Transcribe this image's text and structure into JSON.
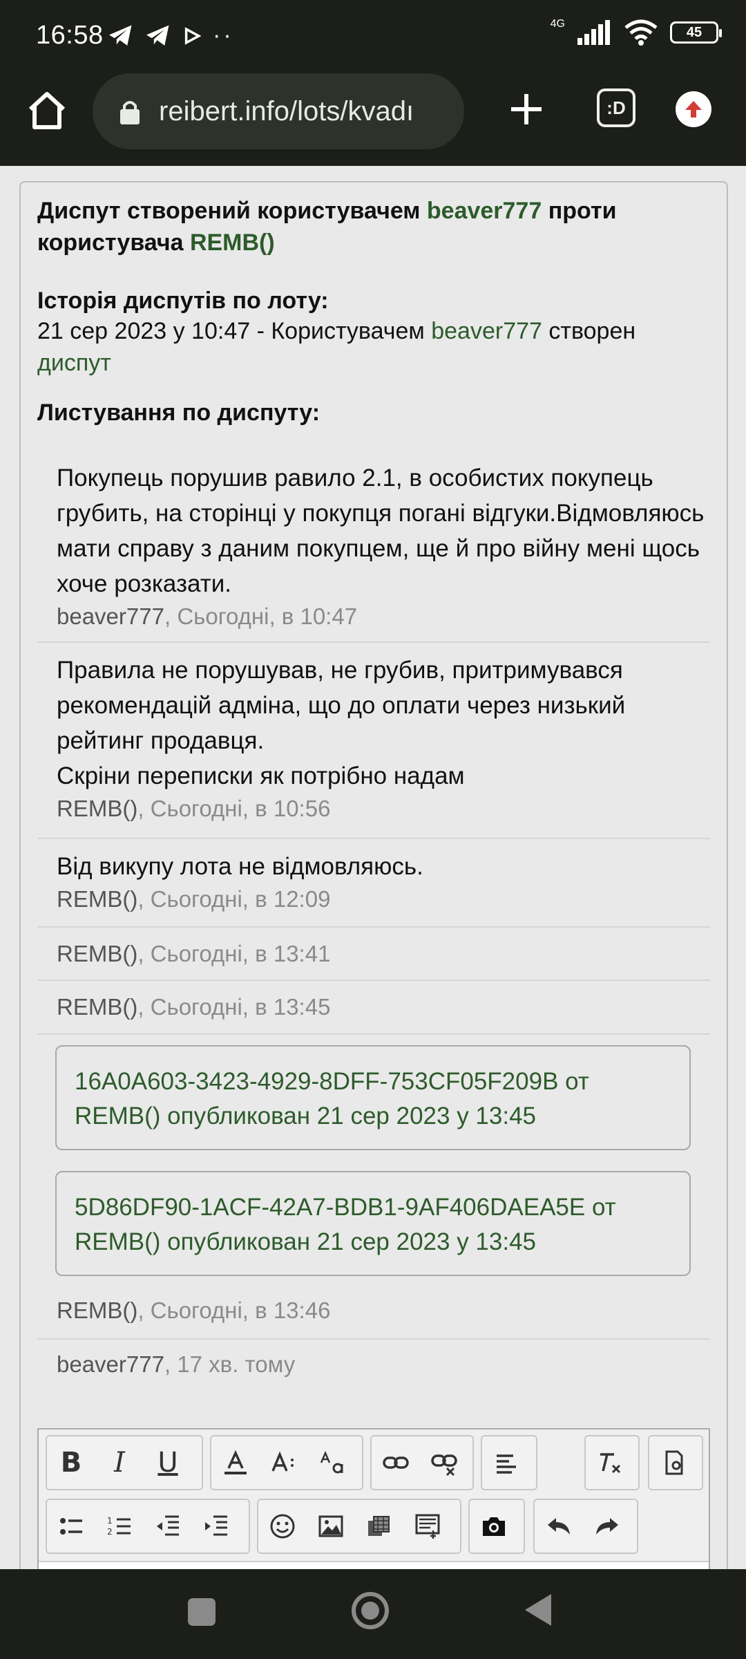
{
  "status": {
    "time": "16:58",
    "network": "4G",
    "battery": "45"
  },
  "browser": {
    "url": "reibert.info/lots/kvadı",
    "tabs_label": ":D"
  },
  "dispute": {
    "title_prefix": "Диспут створений користувачем",
    "initiator": "beaver777",
    "title_middle": "проти",
    "title_line2_prefix": "користувача",
    "respondent": "REMB()",
    "history_heading": "Історія диспутів по лоту:",
    "history_line": "21 сер 2023 у 10:47 - Користувачем",
    "history_user": "beaver777",
    "history_created": "створен",
    "history_link": "диспут",
    "correspondence_heading": "Листування по диспуту:"
  },
  "messages": [
    {
      "text": "Покупець порушив равило 2.1, в особистих покупець грубить, на сторінці у покупця погані відгуки.Відмовляюсь мати справу з даним покупцем, ще й про війну мені щось хоче розказати.",
      "author": "beaver777",
      "time": "Сьогодні, в 10:47"
    },
    {
      "text": "Правила не порушував, не грубив, притримувався рекомендацій адміна, що до оплати через низький рейтинг продавця.\nСкріни переписки як потрібно надам",
      "author": "REMB()",
      "time": "Сьогодні, в 10:56"
    },
    {
      "text": "Від викупу лота не відмовляюсь.",
      "author": "REMB()",
      "time": "Сьогодні, в 12:09"
    },
    {
      "text": "",
      "author": "REMB()",
      "time": "Сьогодні, в 13:41"
    },
    {
      "text": "",
      "author": "REMB()",
      "time": "Сьогодні, в 13:45"
    }
  ],
  "attachments": [
    {
      "id_line": "16A0A603-3423-4929-8DFF-753CF05F209B от",
      "pub_line": "REMB() опубликован 21 сер 2023 у 13:45"
    },
    {
      "id_line": "5D86DF90-1ACF-42A7-BDB1-9AF406DAEA5E от",
      "pub_line": "REMB() опубликован 21 сер 2023 у 13:45"
    }
  ],
  "messages_after": [
    {
      "author": "REMB()",
      "time": "Сьогодні, в 13:46"
    },
    {
      "author": "beaver777",
      "time": "17 хв. тому"
    }
  ],
  "editor": {
    "bold": "B",
    "italic": "I",
    "underline": "U"
  }
}
